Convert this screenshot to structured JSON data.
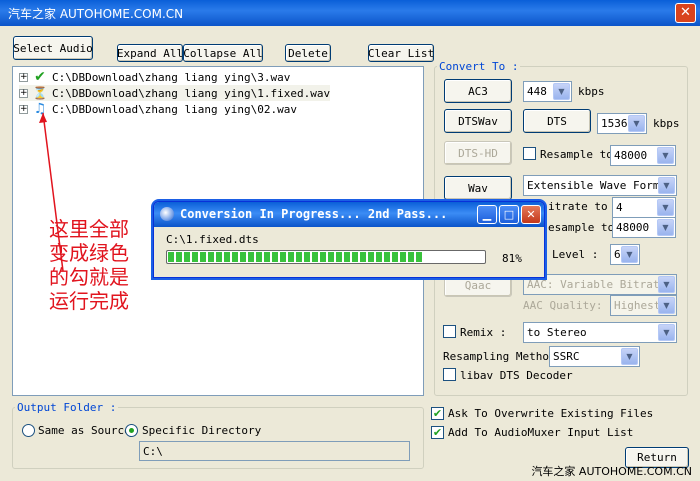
{
  "window": {
    "watermark": "汽车之家 AUTOHOME.COM.CN",
    "close_glyph": "✕"
  },
  "toolbar": {
    "select_audio": "Select Audio",
    "expand_all": "Expand All",
    "collapse_all": "Collapse All",
    "delete": "Delete",
    "clear_list": "Clear List"
  },
  "files": [
    {
      "expander": "+",
      "status": "check",
      "status_glyph": "✔",
      "path": "C:\\DBDownload\\zhang liang ying\\3.wav"
    },
    {
      "expander": "+",
      "status": "hourglass",
      "status_glyph": "⏳",
      "path": "C:\\DBDownload\\zhang liang ying\\1.fixed.wav"
    },
    {
      "expander": "+",
      "status": "music-note",
      "status_glyph": "♫",
      "path": "C:\\DBDownload\\zhang liang ying\\02.wav"
    }
  ],
  "annotation": {
    "lines": [
      "这里全部",
      "变成绿色",
      "的勾就是",
      "运行完成"
    ],
    "color": "#e1141e"
  },
  "convert": {
    "label": "Convert To :",
    "ac3": "AC3",
    "ac3_bitrate": "448",
    "kbps1": "kbps",
    "dtswav": "DTSWav",
    "dts": "DTS",
    "dts_bitrate": "1536",
    "kbps2": "kbps",
    "dtshd": "DTS-HD",
    "resample_label": "Resample to",
    "resample_value": "48000",
    "wav": "Wav",
    "wav_format": "Extensible Wave Format",
    "bitrate_label": "itrate to :",
    "bitrate_value": "4",
    "resample2_label": "esample to",
    "resample2_value": "48000",
    "level_label": "Level :",
    "level_value": "6",
    "qaac": "Qaac",
    "aac_mode": "AAC: Variable Bitrate",
    "aac_quality_label": "AAC Quality:",
    "aac_quality_value": "Highest",
    "remix_label": "Remix :",
    "remix_value": "to Stereo",
    "resampling_method_label": "Resampling Method",
    "resampling_method_value": "SSRC",
    "libav_label": "libav DTS Decoder"
  },
  "output": {
    "label": "Output Folder :",
    "same_as_source": "Same as Source",
    "specific_dir": "Specific Directory",
    "path": "C:\\"
  },
  "options": {
    "overwrite": "Ask To Overwrite Existing Files",
    "add_to_muxer": "Add To AudioMuxer Input List",
    "return": "Return"
  },
  "dialog": {
    "title": "Conversion In Progress... 2nd Pass...",
    "file": "C:\\1.fixed.dts",
    "percent_text": "81%",
    "progress": 0.81
  },
  "footer_watermark": "汽车之家 AUTOHOME.COM.CN",
  "colors": {
    "accent_green": "#21a121",
    "title_blue": "#0a5fd8",
    "label_blue": "#0046d5"
  }
}
